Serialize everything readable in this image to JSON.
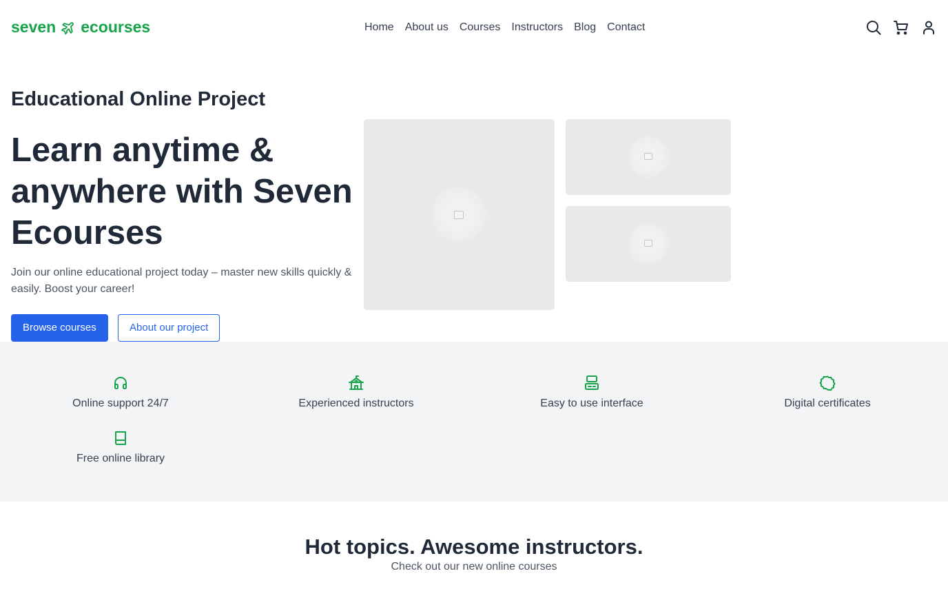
{
  "brand": {
    "name_left": "seven",
    "name_right": "ecourses",
    "icon": "airplane-icon",
    "color": "#16a34a"
  },
  "nav": {
    "items": [
      {
        "label": "Home"
      },
      {
        "label": "About us"
      },
      {
        "label": "Courses"
      },
      {
        "label": "Instructors"
      },
      {
        "label": "Blog"
      },
      {
        "label": "Contact"
      }
    ]
  },
  "header_icons": [
    "search-icon",
    "cart-icon",
    "user-icon"
  ],
  "hero": {
    "eyebrow": "Educational Online Project",
    "title": "Learn anytime & anywhere with Seven Ecourses",
    "subtitle": "Join our online educational project today – master new skills quickly & easily. Boost your career!",
    "primary_button": "Browse courses",
    "secondary_button": "About our project",
    "accent": "#2563eb"
  },
  "features": [
    {
      "label": "Online support 24/7",
      "icon": "headphones-icon"
    },
    {
      "label": "Experienced instructors",
      "icon": "school-building-icon"
    },
    {
      "label": "Easy to use interface",
      "icon": "devices-icon"
    },
    {
      "label": "Digital certificates",
      "icon": "certificate-badge-icon"
    },
    {
      "label": "Free online library",
      "icon": "book-icon"
    }
  ],
  "section": {
    "title": "Hot topics. Awesome instructors.",
    "subtitle": "Check out our new online courses"
  }
}
